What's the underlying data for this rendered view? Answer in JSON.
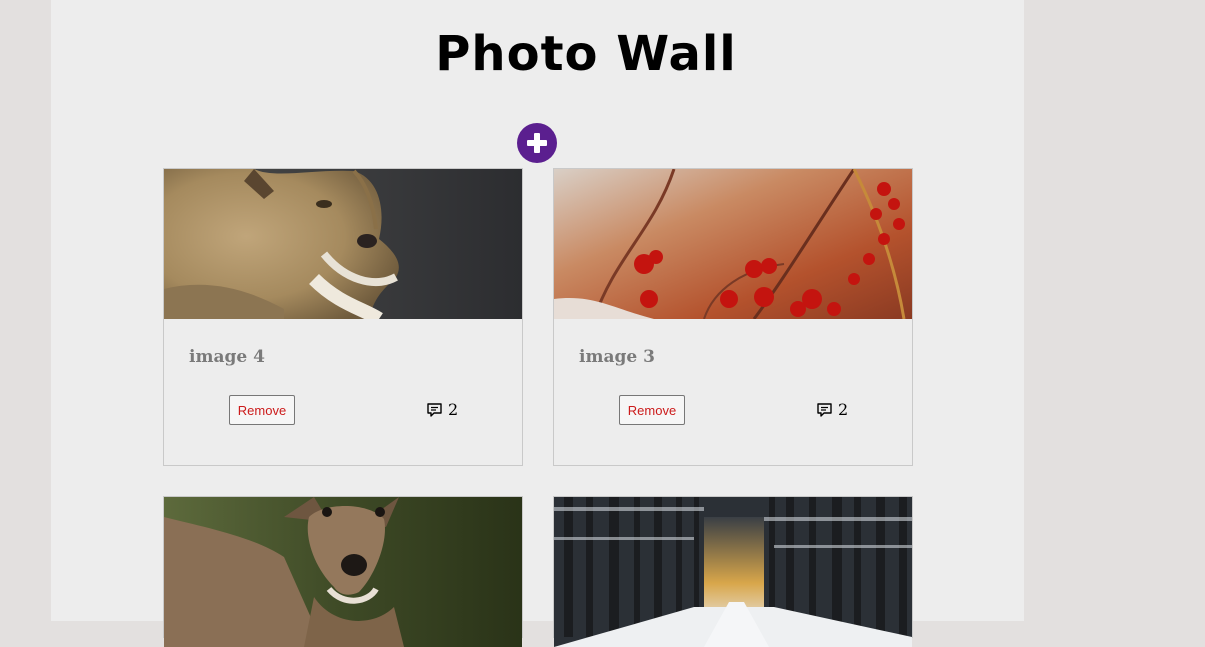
{
  "page": {
    "title": "Photo Wall"
  },
  "add_button": {
    "icon": "plus-icon",
    "color": "#5b1f8f"
  },
  "posts": [
    {
      "caption": "image 4",
      "remove_label": "Remove",
      "comment_count": "2",
      "photo": "lioness-photo"
    },
    {
      "caption": "image 3",
      "remove_label": "Remove",
      "comment_count": "2",
      "photo": "red-berries-photo"
    },
    {
      "caption": "",
      "remove_label": "",
      "comment_count": "",
      "photo": "deer-photo"
    },
    {
      "caption": "",
      "remove_label": "",
      "comment_count": "",
      "photo": "snowy-forest-photo"
    }
  ],
  "colors": {
    "remove_text": "#cc1b1b",
    "caption_text": "#7a7a7a",
    "background": "#e3e0df",
    "content_background": "#ededed"
  }
}
